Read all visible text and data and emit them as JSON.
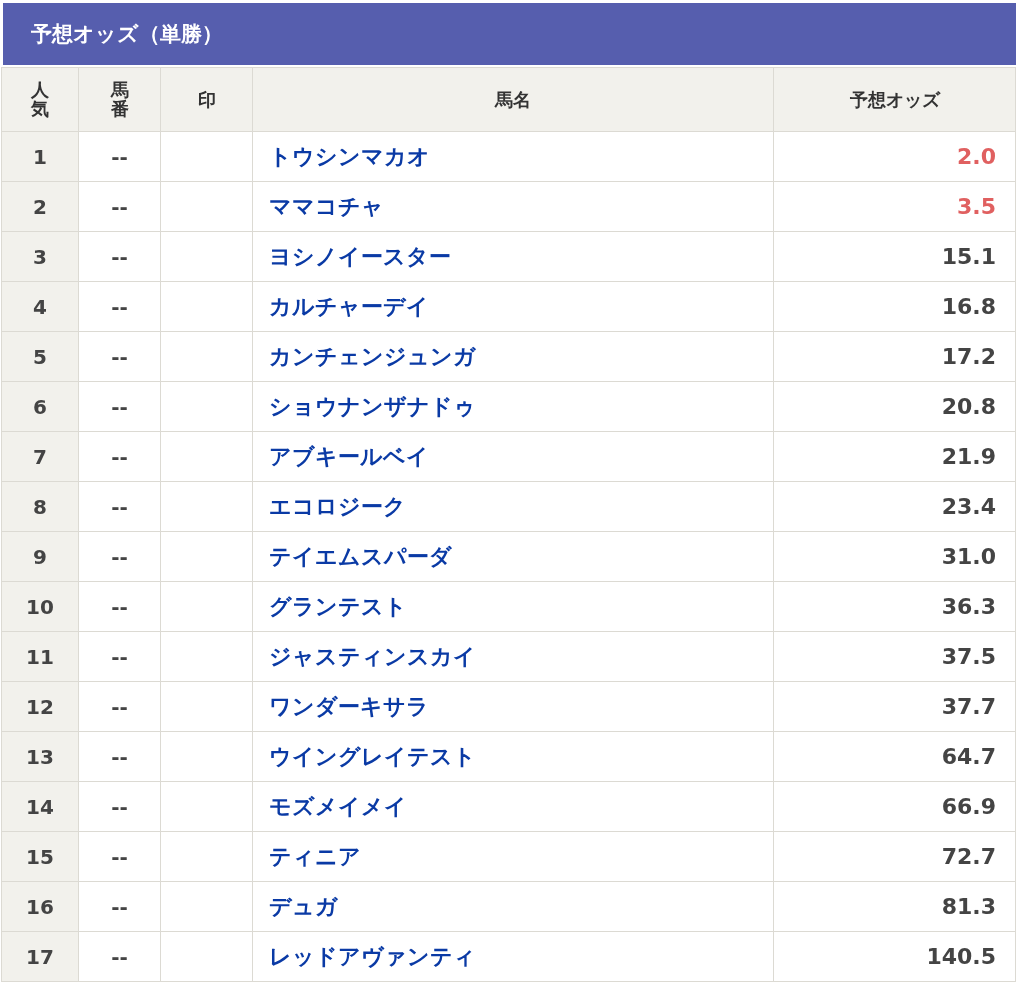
{
  "title": "予想オッズ（単勝）",
  "table": {
    "columns": [
      "人気",
      "馬番",
      "印",
      "馬名",
      "予想オッズ"
    ],
    "rows": [
      {
        "rank": "1",
        "number": "--",
        "mark": "",
        "name": "トウシンマカオ",
        "odds": "2.0",
        "highlight": true
      },
      {
        "rank": "2",
        "number": "--",
        "mark": "",
        "name": "ママコチャ",
        "odds": "3.5",
        "highlight": true
      },
      {
        "rank": "3",
        "number": "--",
        "mark": "",
        "name": "ヨシノイースター",
        "odds": "15.1",
        "highlight": false
      },
      {
        "rank": "4",
        "number": "--",
        "mark": "",
        "name": "カルチャーデイ",
        "odds": "16.8",
        "highlight": false
      },
      {
        "rank": "5",
        "number": "--",
        "mark": "",
        "name": "カンチェンジュンガ",
        "odds": "17.2",
        "highlight": false
      },
      {
        "rank": "6",
        "number": "--",
        "mark": "",
        "name": "ショウナンザナドゥ",
        "odds": "20.8",
        "highlight": false
      },
      {
        "rank": "7",
        "number": "--",
        "mark": "",
        "name": "アブキールベイ",
        "odds": "21.9",
        "highlight": false
      },
      {
        "rank": "8",
        "number": "--",
        "mark": "",
        "name": "エコロジーク",
        "odds": "23.4",
        "highlight": false
      },
      {
        "rank": "9",
        "number": "--",
        "mark": "",
        "name": "テイエムスパーダ",
        "odds": "31.0",
        "highlight": false
      },
      {
        "rank": "10",
        "number": "--",
        "mark": "",
        "name": "グランテスト",
        "odds": "36.3",
        "highlight": false
      },
      {
        "rank": "11",
        "number": "--",
        "mark": "",
        "name": "ジャスティンスカイ",
        "odds": "37.5",
        "highlight": false
      },
      {
        "rank": "12",
        "number": "--",
        "mark": "",
        "name": "ワンダーキサラ",
        "odds": "37.7",
        "highlight": false
      },
      {
        "rank": "13",
        "number": "--",
        "mark": "",
        "name": "ウイングレイテスト",
        "odds": "64.7",
        "highlight": false
      },
      {
        "rank": "14",
        "number": "--",
        "mark": "",
        "name": "モズメイメイ",
        "odds": "66.9",
        "highlight": false
      },
      {
        "rank": "15",
        "number": "--",
        "mark": "",
        "name": "ティニア",
        "odds": "72.7",
        "highlight": false
      },
      {
        "rank": "16",
        "number": "--",
        "mark": "",
        "name": "デュガ",
        "odds": "81.3",
        "highlight": false
      },
      {
        "rank": "17",
        "number": "--",
        "mark": "",
        "name": "レッドアヴァンティ",
        "odds": "140.5",
        "highlight": false
      }
    ]
  }
}
